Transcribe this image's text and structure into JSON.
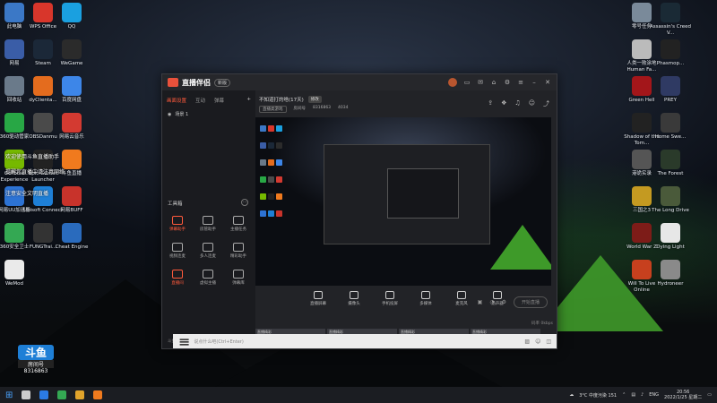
{
  "desktop": {
    "left_icons": [
      {
        "label": "此电脑",
        "color": "#3b78c6"
      },
      {
        "label": "WPS Office",
        "color": "#d8362b"
      },
      {
        "label": "QQ",
        "color": "#1aa0e0"
      },
      {
        "label": "网易",
        "color": "#3a5da7"
      },
      {
        "label": "Steam",
        "color": "#1b2838"
      },
      {
        "label": "WeGame",
        "color": "#2b2b2b"
      },
      {
        "label": "回收站",
        "color": "#6a7a8a"
      },
      {
        "label": "dyClienta...",
        "color": "#e46c1e"
      },
      {
        "label": "百度网盘",
        "color": "#3d86e8"
      },
      {
        "label": "360驱动管家",
        "color": "#28a745"
      },
      {
        "label": "OBSDanmu",
        "color": "#4a4a4a"
      },
      {
        "label": "网易云音乐",
        "color": "#d33a31"
      },
      {
        "label": "GeForce Experience",
        "color": "#76b900"
      },
      {
        "label": "Epic Games Launcher",
        "color": "#222"
      },
      {
        "label": "斗鱼直播",
        "color": "#f07a1e"
      },
      {
        "label": "网易UU加速器",
        "color": "#2d73d4"
      },
      {
        "label": "Ubisoft Connect",
        "color": "#1e7fd6"
      },
      {
        "label": "网易BUFF",
        "color": "#c8332b"
      },
      {
        "label": "360安全卫士",
        "color": "#34a853"
      },
      {
        "label": "FUNGTrai...",
        "color": "#333"
      },
      {
        "label": "Cheat Engine",
        "color": "#2a6bbd"
      },
      {
        "label": "WeMod",
        "color": "#eaeaea"
      }
    ],
    "right_icons": [
      {
        "label": "零号任务",
        "color": "#7a8a9a"
      },
      {
        "label": "Assassin's Creed V...",
        "color": "#1a2a35"
      },
      {
        "label": "人类一败涂地 Human Fa...",
        "color": "#bbb"
      },
      {
        "label": "Phasmop...",
        "color": "#222"
      },
      {
        "label": "Green Hell",
        "color": "#a3161a"
      },
      {
        "label": "PREY",
        "color": "#2f3a63"
      },
      {
        "label": "Shadow of the Tom...",
        "color": "#222"
      },
      {
        "label": "Home Swe...",
        "color": "#3a3a3a"
      },
      {
        "label": "港诡实录",
        "color": "#555"
      },
      {
        "label": "The Forest",
        "color": "#2a3a2a"
      },
      {
        "label": "三国之3",
        "color": "#c49a21"
      },
      {
        "label": "The Long Drive",
        "color": "#4a5a3a"
      },
      {
        "label": "World War Z",
        "color": "#7d1c18"
      },
      {
        "label": "Dying Light",
        "color": "#e7e7e7"
      },
      {
        "label": "Will To Live Online",
        "color": "#c7401e"
      },
      {
        "label": "Hydroneer",
        "color": "#8a8a8a"
      }
    ],
    "overlay_lines": [
      "欢迎使用斗鱼直播助手",
      "提醒您直播中请注意网络",
      "注意安全文明直播"
    ],
    "watermark": {
      "brand": "斗鱼",
      "room_label": "房间号",
      "room_id": "8316863"
    }
  },
  "window": {
    "app_name": "直播伴侣",
    "version_badge": "新版",
    "title_icons": [
      "avatar",
      "message-icon",
      "mail-icon",
      "shirt-icon",
      "settings-icon",
      "menu-icon",
      "minimize-icon",
      "close-icon"
    ],
    "left_tabs": [
      "画面设置",
      "互动",
      "弹幕"
    ],
    "add_tab": "+",
    "scene_label": "场景 1",
    "tools_header": "工具箱",
    "tools_more": "···",
    "tools": [
      {
        "label": "弹幕助手",
        "hot": true
      },
      {
        "label": "房管助手",
        "hot": false
      },
      {
        "label": "主播任务",
        "hot": false
      },
      {
        "label": "视频连麦",
        "hot": false
      },
      {
        "label": "多人连麦",
        "hot": false
      },
      {
        "label": "精彩助手",
        "hot": false
      },
      {
        "label": "直播间",
        "hot": true
      },
      {
        "label": "虚拟主播",
        "hot": false
      },
      {
        "label": "弹幕库",
        "hot": false
      }
    ],
    "left_bottom_note": "斗鱼直播伴侣使用帮助",
    "stream_title": "不知道打的啥(17天)",
    "edit_tag": "修改",
    "category": "直播类游戏",
    "room_number_label": "房间号",
    "room_number": "8316863",
    "viewer_count": "4034",
    "header_icons": [
      "share-icon",
      "gift-icon",
      "bell-icon",
      "user-icon",
      "link-icon"
    ],
    "controls": [
      {
        "label": "直播屏幕",
        "icon": "monitor-icon"
      },
      {
        "label": "摄像头",
        "icon": "camera-icon"
      },
      {
        "label": "手机投屏",
        "icon": "phone-icon"
      },
      {
        "label": "多媒体",
        "icon": "media-icon"
      },
      {
        "label": "麦克风",
        "icon": "mic-icon"
      },
      {
        "label": "扬声器",
        "icon": "speaker-icon"
      }
    ],
    "start_button": "开始直播",
    "bitrate_info": "码率 0kbps",
    "thumb_labels": [
      "直播精彩",
      "直播精彩",
      "直播精彩",
      "直播精彩"
    ],
    "chat_placeholder": "说点什么吧(Ctrl+Enter)"
  },
  "taskbar": {
    "weather": "3°C 中度污染 151",
    "lang": "ENG",
    "time": "20:56",
    "date": "2022/1/25 星期二"
  }
}
